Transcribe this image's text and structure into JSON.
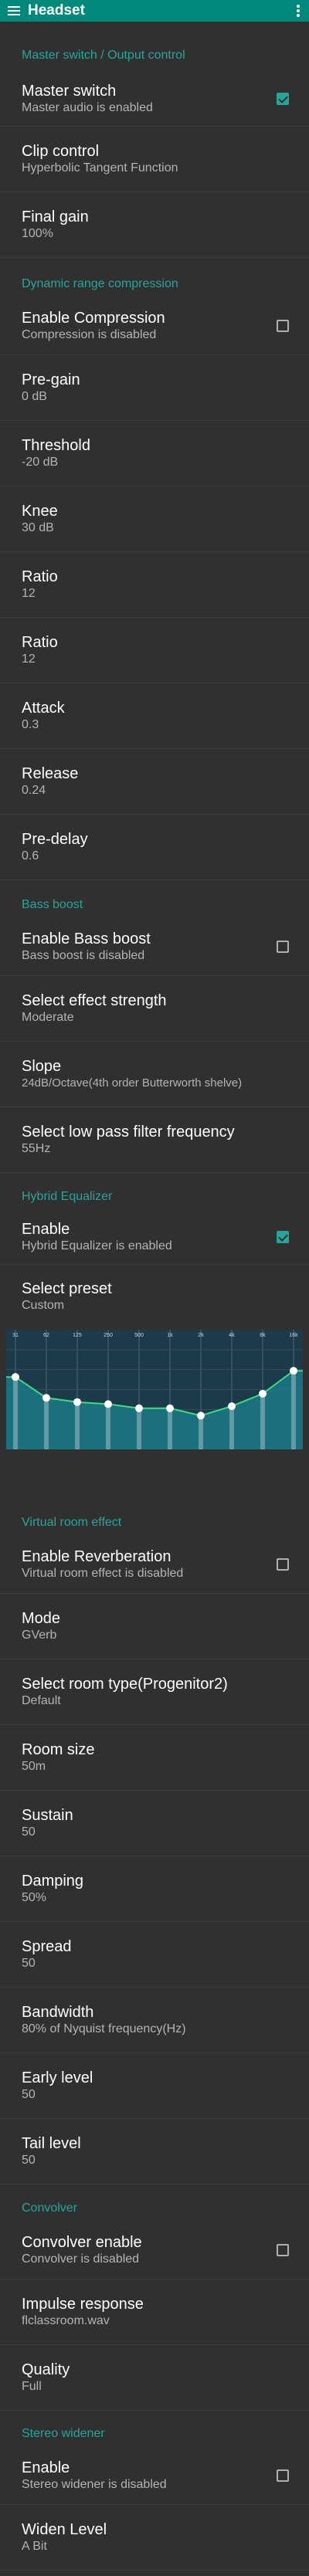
{
  "appbar": {
    "title": "Headset",
    "menu_icon": "menu-icon",
    "overflow_icon": "more-vert-icon"
  },
  "colors": {
    "accent": "#26a69a",
    "appbar": "#00897b",
    "background": "#303030"
  },
  "sections": {
    "master": "Master switch / Output control",
    "drc": "Dynamic range compression",
    "bass": "Bass boost",
    "eq": "Hybrid Equalizer",
    "reverb": "Virtual room effect",
    "convolver": "Convolver",
    "widener": "Stereo widener"
  },
  "prefs": {
    "master_switch": {
      "title": "Master switch",
      "summary": "Master audio is enabled",
      "checked": true
    },
    "clip_control": {
      "title": "Clip control",
      "summary": "Hyperbolic Tangent Function"
    },
    "final_gain": {
      "title": "Final gain",
      "summary": "100%"
    },
    "enable_compression": {
      "title": "Enable Compression",
      "summary": "Compression is disabled",
      "checked": false
    },
    "pregain": {
      "title": "Pre-gain",
      "summary": "0 dB"
    },
    "threshold": {
      "title": "Threshold",
      "summary": "-20 dB"
    },
    "knee": {
      "title": "Knee",
      "summary": "30 dB"
    },
    "ratio1": {
      "title": "Ratio",
      "summary": "12"
    },
    "ratio2": {
      "title": "Ratio",
      "summary": "12"
    },
    "attack": {
      "title": "Attack",
      "summary": "0.3"
    },
    "release": {
      "title": "Release",
      "summary": "0.24"
    },
    "predelay": {
      "title": "Pre-delay",
      "summary": "0.6"
    },
    "enable_bass": {
      "title": "Enable Bass boost",
      "summary": "Bass boost is disabled",
      "checked": false
    },
    "effect_strength": {
      "title": "Select effect strength",
      "summary": "Moderate"
    },
    "slope": {
      "title": "Slope",
      "summary": "24dB/Octave(4th order Butterworth shelve)"
    },
    "lowpass": {
      "title": "Select low pass filter frequency",
      "summary": "55Hz"
    },
    "eq_enable": {
      "title": "Enable",
      "summary": "Hybrid Equalizer is enabled",
      "checked": true
    },
    "preset": {
      "title": "Select preset",
      "summary": "Custom"
    },
    "enable_reverb": {
      "title": "Enable Reverberation",
      "summary": "Virtual room effect is disabled",
      "checked": false
    },
    "mode": {
      "title": "Mode",
      "summary": "GVerb"
    },
    "room_type": {
      "title": "Select room type(Progenitor2)",
      "summary": "Default"
    },
    "room_size": {
      "title": "Room size",
      "summary": "50m"
    },
    "sustain": {
      "title": "Sustain",
      "summary": "50"
    },
    "damping": {
      "title": "Damping",
      "summary": "50%"
    },
    "spread": {
      "title": "Spread",
      "summary": "50"
    },
    "bandwidth": {
      "title": "Bandwidth",
      "summary": "80% of Nyquist frequency(Hz)"
    },
    "early_level": {
      "title": "Early level",
      "summary": "50"
    },
    "tail_level": {
      "title": "Tail level",
      "summary": "50"
    },
    "convolver_enable": {
      "title": "Convolver enable",
      "summary": "Convolver is disabled",
      "checked": false
    },
    "impulse": {
      "title": "Impulse response",
      "summary": "flclassroom.wav"
    },
    "quality": {
      "title": "Quality",
      "summary": "Full"
    },
    "widener_enable": {
      "title": "Enable",
      "summary": "Stereo widener is disabled",
      "checked": false
    },
    "widen_level": {
      "title": "Widen Level",
      "summary": "A Bit"
    }
  },
  "equalizer": {
    "band_labels": [
      "31",
      "62",
      "125",
      "250",
      "500",
      "1k",
      "2k",
      "4k",
      "8k",
      "16k"
    ],
    "band_levels": [
      0.38,
      0.58,
      0.62,
      0.64,
      0.68,
      0.68,
      0.75,
      0.66,
      0.54,
      0.32
    ]
  }
}
